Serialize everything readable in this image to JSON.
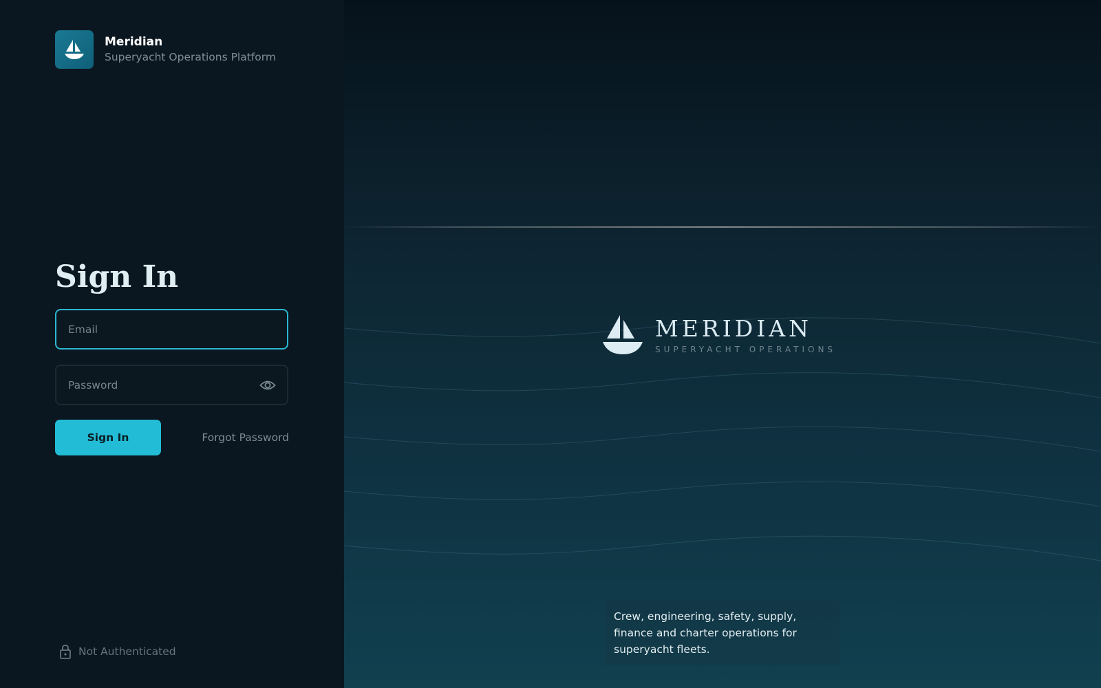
{
  "brand": {
    "name": "Meridian",
    "tagline": "Superyacht Operations Platform",
    "logo_icon": "sailboat-icon"
  },
  "signin": {
    "title": "Sign In",
    "email_placeholder": "Email",
    "email_value": "",
    "password_placeholder": "Password",
    "password_value": "",
    "password_toggle_icon": "eye-icon",
    "submit_label": "Sign In",
    "forgot_label": "Forgot Password"
  },
  "status": {
    "icon": "lock-icon",
    "label": "Not Authenticated"
  },
  "hero": {
    "title": "MERIDIAN",
    "subtitle": "SUPERYACHT OPERATIONS",
    "caption": "Crew, engineering, safety, supply, finance and charter operations for superyacht fleets."
  },
  "colors": {
    "accent": "#22bcd6",
    "focus_border": "#2bb7d3",
    "left_background": "#0b1720",
    "brand_logo_background": "#1a7a94"
  }
}
